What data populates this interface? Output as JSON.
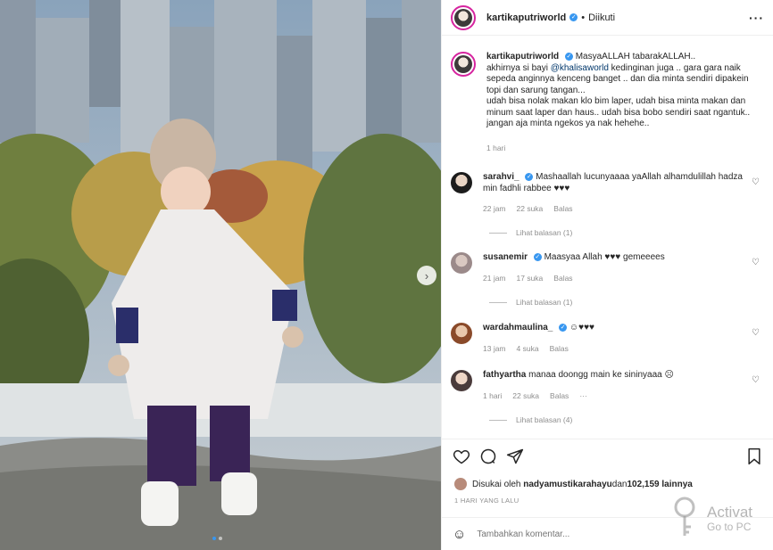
{
  "post": {
    "username": "kartikaputriworld",
    "follow_status": "Diikuti",
    "more_icon": "more-horizontal-icon",
    "caption_line1": "MasyaALLAH tabarakALLAH..",
    "caption_mention_pre": "akhirnya si bayi ",
    "caption_mention": "@khalisaworld",
    "caption_mention_post": " kedinginan juga .. gara gara naik sepeda anginnya kenceng banget .. dan dia minta sendiri dipakein topi dan sarung tangan...",
    "caption_line3": "udah bisa nolak makan klo bim laper, udah bisa minta makan dan minum saat laper dan haus.. udah bisa bobo sendiri saat ngantuk.. jangan aja minta ngekos ya nak hehehe..",
    "caption_time": "1 hari"
  },
  "comments": [
    {
      "username": "sarahvi_",
      "verified": true,
      "text": "Mashaallah lucunyaaaa yaAllah alhamdulillah hadza min fadhli rabbee ♥♥♥",
      "time": "22 jam",
      "likes": "22 suka",
      "reply": "Balas",
      "view_replies": "Lihat balasan (1)"
    },
    {
      "username": "susanemir",
      "verified": true,
      "text": "Maasyaa Allah ♥♥♥ gemeeees",
      "time": "21 jam",
      "likes": "17 suka",
      "reply": "Balas",
      "view_replies": "Lihat balasan (1)"
    },
    {
      "username": "wardahmaulina_",
      "verified": true,
      "text": "☺♥♥♥",
      "time": "13 jam",
      "likes": "4 suka",
      "reply": "Balas",
      "view_replies": ""
    },
    {
      "username": "fathyartha",
      "verified": false,
      "text": "manaa doongg main ke sininyaaa ☹",
      "time": "1 hari",
      "likes": "22 suka",
      "reply": "Balas",
      "options": "···",
      "view_replies": "Lihat balasan (4)"
    }
  ],
  "actions": {
    "like_icon": "heart-icon",
    "comment_icon": "comment-icon",
    "share_icon": "send-icon",
    "save_icon": "bookmark-icon"
  },
  "likes": {
    "prefix": "Disukai oleh ",
    "user": "nadyamustikarahayu",
    "middle": " dan ",
    "count": "102,159 lainnya"
  },
  "timestamp": "1 HARI YANG LALU",
  "comment_input": {
    "placeholder": "Tambahkan komentar..."
  },
  "carousel": {
    "slides": 2,
    "active": 1
  },
  "watermark": {
    "title": "Activat",
    "subtitle": "Go to PC"
  },
  "colors": {
    "accent": "#3897f0",
    "story_ring": "#d6249f"
  }
}
